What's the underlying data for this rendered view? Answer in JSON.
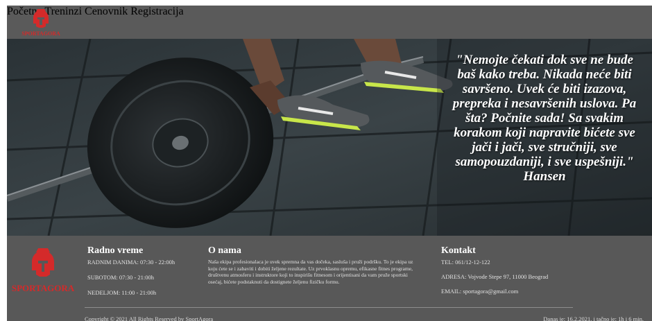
{
  "brand": {
    "logo_text": "SPORTAGORA",
    "logo_color": "#d42a2a"
  },
  "nav": {
    "items": [
      {
        "label": "Početna"
      },
      {
        "label": "Treninzi"
      },
      {
        "label": "Cenovnik"
      },
      {
        "label": "Registracija"
      }
    ]
  },
  "hero": {
    "quote": "\"Nemojte čekati dok sve ne bude baš kako treba. Nikada neće biti savršeno. Uvek će biti izazova, prepreka i nesavršenih uslova. Pa šta? Počnite sada! Sa svakim korakom koji napravite bićete sve jači i jači, sve stručniji, sve samopouzdaniji, i sve uspešniji.\"",
    "author": "Hansen"
  },
  "footer": {
    "hours": {
      "title": "Radno vreme",
      "lines": [
        "RADNIM DANIMA: 07:30 - 22:00h",
        "SUBOTOM: 07:30 - 21:00h",
        "NEDELJOM: 11:00 - 21:00h"
      ]
    },
    "about": {
      "title": "O nama",
      "text": "Naša ekipa profesionalaca je uvek spremna da vas dočeka, sasluša i pruži podršku. To je ekipa uz koju ćete se i zabaviti i dobiti željene rezultate. Uz prvoklasnu opremu, efikasne fitnes programe, društvenu atmosferu i instruktore koji to inspirišu fitnesom i orijentisani da vam pruže sportski osećaj, bićete podstaknuti da dostignete željenu fizičku formu."
    },
    "contact": {
      "title": "Kontakt",
      "lines": [
        "TEL: 061/12-12-122",
        "ADRESA: Vojvode Stepe 97, 11000 Beograd",
        "EMAIL: sportagora@gmail.com"
      ]
    },
    "copyright": "Copyright © 2021 All Rights Reserved by SportAgora",
    "date_text": "Danas je: 16.2.2021. i tačno je: 1h i 6 min."
  }
}
